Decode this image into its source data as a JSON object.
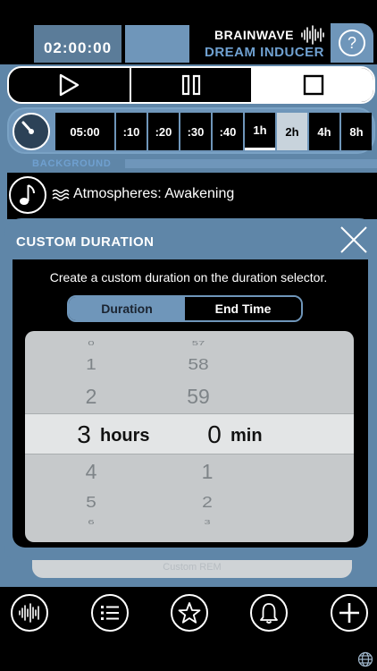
{
  "header": {
    "timer": "02:00:00",
    "brand_line1": "BRAINWAVE",
    "brand_line2": "DREAM INDUCER",
    "help_label": "?"
  },
  "transport": {
    "buttons": [
      {
        "name": "play",
        "active": false
      },
      {
        "name": "pause",
        "active": false
      },
      {
        "name": "stop",
        "active": true
      }
    ]
  },
  "duration": {
    "custom_value": "05:00",
    "options": [
      ":10",
      ":20",
      ":30",
      ":40",
      "1h",
      "2h",
      "4h",
      "8h"
    ],
    "selected": "1h",
    "highlighted": "2h"
  },
  "background": {
    "section_label": "BACKGROUND",
    "track": "Atmospheres: Awakening"
  },
  "modal": {
    "title": "CUSTOM DURATION",
    "description": "Create a custom duration on the duration selector.",
    "tabs": [
      "Duration",
      "End Time"
    ],
    "active_tab": "Duration",
    "hours_wheel": {
      "above": [
        "0",
        "1",
        "2"
      ],
      "selected": "3",
      "below": [
        "4",
        "5",
        "6"
      ],
      "unit": "hours"
    },
    "minutes_wheel": {
      "above": [
        "57",
        "58",
        "59"
      ],
      "selected": "0",
      "below": [
        "1",
        "2",
        "3"
      ],
      "unit": "min"
    },
    "ghost_text": "Custom REM"
  },
  "nav": {
    "items": [
      "waveform-icon",
      "list-icon",
      "star-icon",
      "bell-icon",
      "plus-icon"
    ]
  },
  "colors": {
    "accent": "#6f96ba",
    "frame": "#5f86a8",
    "brand_secondary": "#6fa0d0",
    "picker_bg": "#c6c9cb"
  }
}
